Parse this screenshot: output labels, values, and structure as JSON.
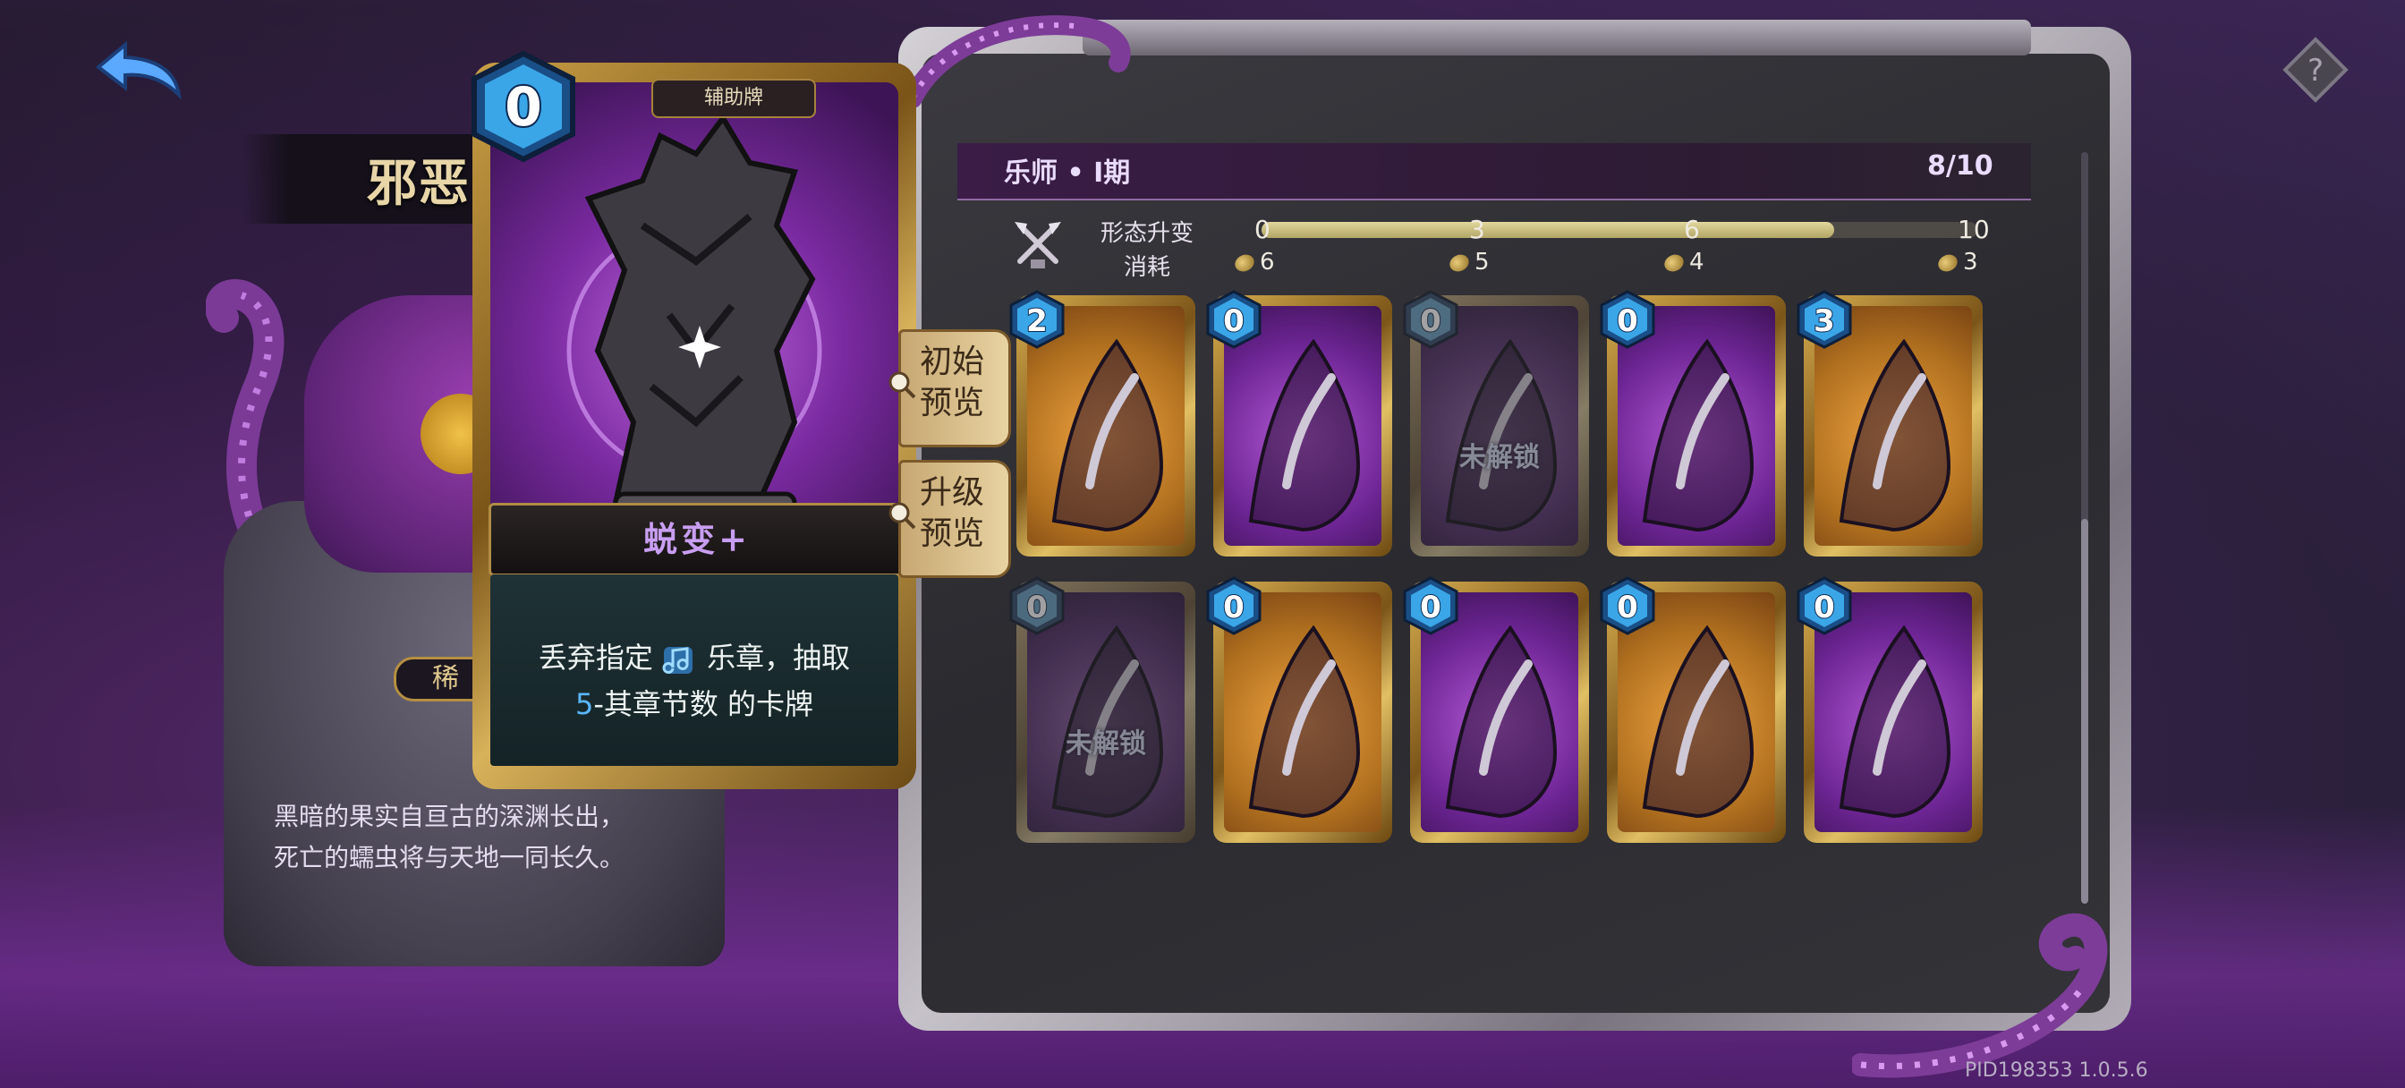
{
  "nav": {
    "back_icon": "back-arrow-icon",
    "help_icon": "help-icon"
  },
  "character": {
    "title": "邪恶",
    "rarity": "稀",
    "lore_line1": "黑暗的果实自亘古的深渊长出，",
    "lore_line2": "死亡的蠕虫将与天地一同长久。"
  },
  "selected_card": {
    "cost": "0",
    "type_tag": "辅助牌",
    "name": "蜕变+",
    "desc_line1_prefix": "丢弃指定",
    "desc_line1_suffix": "乐章，抽取",
    "desc_line2_number": "5",
    "desc_line2_rest": "-其章节数 的卡牌"
  },
  "preview_buttons": {
    "initial": {
      "line1": "初始",
      "line2": "预览"
    },
    "upgrade": {
      "line1": "升级",
      "line2": "预览"
    }
  },
  "series": {
    "name": "乐师 • I期",
    "count": "8/10"
  },
  "evolution": {
    "label": "形态升变",
    "cost_label": "消耗",
    "ticks": [
      "0",
      "3",
      "6",
      "10"
    ],
    "tick_values": [
      0,
      3,
      6,
      10
    ],
    "costs": [
      "6",
      "5",
      "4",
      "3"
    ],
    "progress": 8,
    "max": 10
  },
  "cards": [
    {
      "cost": "2",
      "theme": "orange",
      "locked": false
    },
    {
      "cost": "0",
      "theme": "purple",
      "locked": false
    },
    {
      "cost": "0",
      "theme": "purple",
      "locked": true,
      "lock_text": "未解锁"
    },
    {
      "cost": "0",
      "theme": "purple",
      "locked": false
    },
    {
      "cost": "3",
      "theme": "orange",
      "locked": false
    },
    {
      "cost": "0",
      "theme": "purple",
      "locked": true,
      "lock_text": "未解锁"
    },
    {
      "cost": "0",
      "theme": "orange",
      "locked": false
    },
    {
      "cost": "0",
      "theme": "purple",
      "locked": false
    },
    {
      "cost": "0",
      "theme": "orange",
      "locked": false
    },
    {
      "cost": "0",
      "theme": "purple",
      "locked": false
    }
  ],
  "version": "PID198353  1.0.5.6",
  "colors": {
    "accent_blue": "#5ab7ff",
    "name_purple": "#c89ef2",
    "gold": "#caa046"
  }
}
